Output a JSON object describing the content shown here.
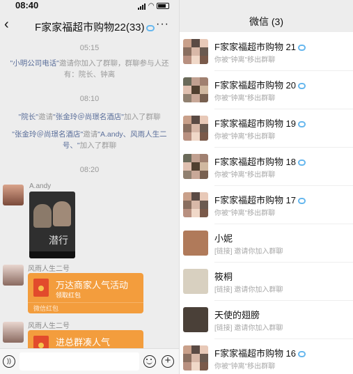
{
  "left": {
    "status_time": "08:40",
    "header": {
      "back_icon": "‹",
      "title": "F家家福超市购物22(33)",
      "more_icon": "···"
    },
    "messages": {
      "ts1": "05:15",
      "sys1_name1": "\"小明公司电话\"",
      "sys1_text": "邀请你加入了群聊，群聊参与人还有：院长、钟离",
      "ts2": "08:10",
      "sys2_name1": "\"院长\"",
      "sys2_mid": "邀请",
      "sys2_name2": "\"张金玲＠尚璟名酒店\"",
      "sys2_end": "加入了群聊",
      "sys3_name1": "\"张金玲＠尚璟名酒店\"",
      "sys3_mid": "邀请",
      "sys3_name2": "\"A.andy、风雨人生二号、\"",
      "sys3_end": "加入了群聊",
      "ts3": "08:20",
      "sender1": "A.andy",
      "poster_text": "潜行",
      "sender2": "风雨人生二号",
      "rp1_title": "万达商家人气活动",
      "rp1_sub": "领取红包",
      "rp1_footer": "微信红包",
      "sender3": "风雨人生二号",
      "rp2_title": "进总群凑人气"
    },
    "input": {
      "voice_icon": "voice-icon",
      "emoji_icon": "emoji-icon",
      "plus_icon": "plus-icon"
    }
  },
  "right": {
    "title": "微信 (3)",
    "rows": [
      {
        "name": "F家家福超市购物 21",
        "sub": "你被\"钟离\"移出群聊",
        "group": true
      },
      {
        "name": "F家家福超市购物 20",
        "sub": "你被\"钟离\"移出群聊",
        "group": true
      },
      {
        "name": "F家家福超市购物 19",
        "sub": "你被\"钟离\"移出群聊",
        "group": true
      },
      {
        "name": "F家家福超市购物 18",
        "sub": "你被\"钟离\"移出群聊",
        "group": true
      },
      {
        "name": "F家家福超市购物 17",
        "sub": "你被\"钟离\"移出群聊",
        "group": true
      },
      {
        "name": "小妮",
        "sub": "[链接] 邀请你加入群聊",
        "group": false
      },
      {
        "name": "筱桐",
        "sub": "[链接] 邀请你加入群聊",
        "group": false
      },
      {
        "name": "天使的翅膀",
        "sub": "[链接] 邀请你加入群聊",
        "group": false
      },
      {
        "name": "F家家福超市购物 16",
        "sub": "你被\"钟离\"移出群聊",
        "group": true
      }
    ]
  }
}
